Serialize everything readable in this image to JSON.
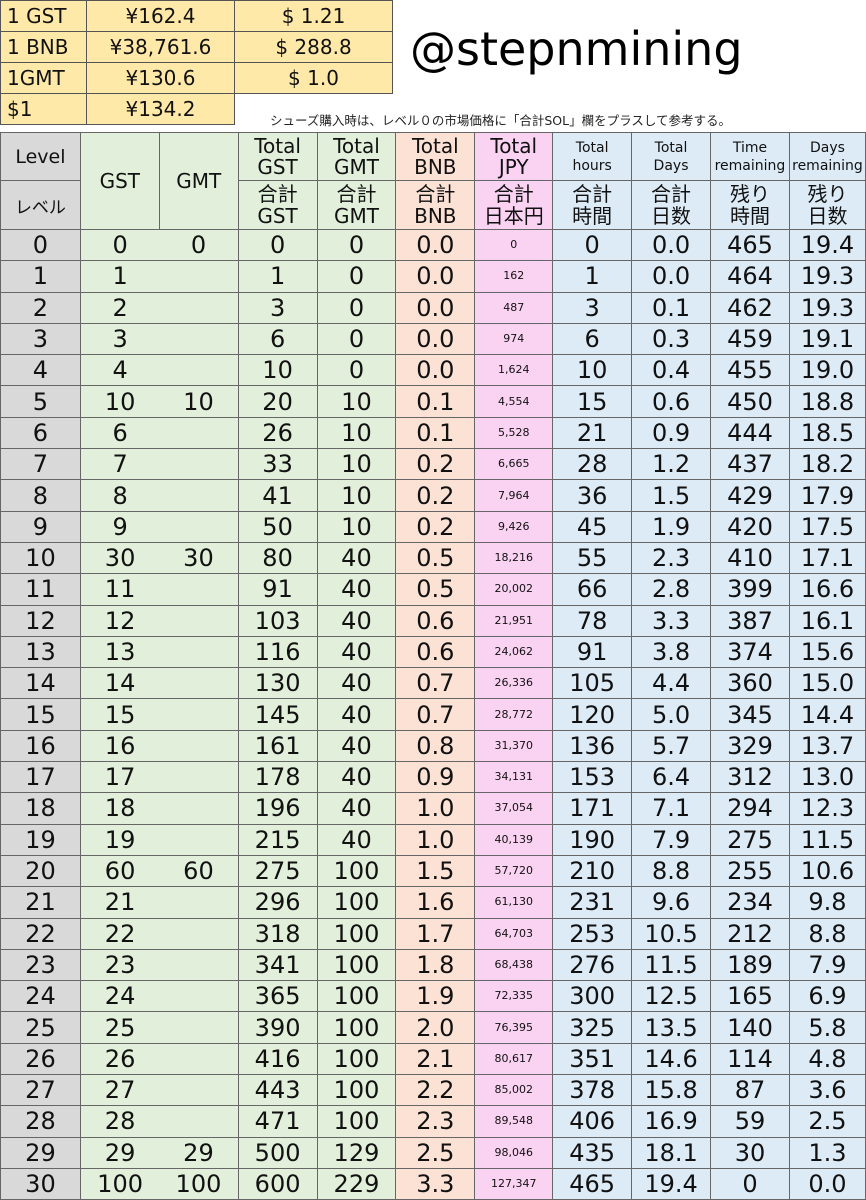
{
  "prices": [
    {
      "unit": "1 GST",
      "jpy": "¥162.4",
      "usd": "$ 1.21"
    },
    {
      "unit": "1 BNB",
      "jpy": "¥38,761.6",
      "usd": "$ 288.8"
    },
    {
      "unit": "1GMT",
      "jpy": "¥130.6",
      "usd": "$ 1.0"
    },
    {
      "unit": "$1",
      "jpy": "¥134.2",
      "usd": ""
    }
  ],
  "handle": "@stepnmining",
  "note": "シューズ購入時は、レベル０の市場価格に「合計SOL」欄をプラスして参考する。",
  "header": {
    "level_en": "Level",
    "level_jp": "レベル",
    "gst": "GST",
    "gmt": "GMT",
    "total_gst": [
      "Total",
      "GST"
    ],
    "total_gmt": [
      "Total",
      "GMT"
    ],
    "total_bnb": [
      "Total",
      "BNB"
    ],
    "total_jpy": [
      "Total",
      "JPY"
    ],
    "total_hours": [
      "Total",
      "hours"
    ],
    "total_days": [
      "Total",
      "Days"
    ],
    "time_remaining": [
      "Time",
      "remaining"
    ],
    "days_remaining": [
      "Days",
      "remaining"
    ],
    "jp_total_gst": [
      "合計",
      "GST"
    ],
    "jp_total_gmt": [
      "合計",
      "GMT"
    ],
    "jp_total_bnb": [
      "合計",
      "BNB"
    ],
    "jp_total_jpy": [
      "合計",
      "日本円"
    ],
    "jp_total_hours": [
      "合計",
      "時間"
    ],
    "jp_total_days": [
      "合計",
      "日数"
    ],
    "jp_time_remaining": [
      "残り",
      "時間"
    ],
    "jp_days_remaining": [
      "残り",
      "日数"
    ]
  },
  "rows": [
    [
      "0",
      "0",
      "0",
      "0",
      "0",
      "0.0",
      "0",
      "0",
      "0.0",
      "465",
      "19.4"
    ],
    [
      "1",
      "1",
      "",
      "1",
      "0",
      "0.0",
      "162",
      "1",
      "0.0",
      "464",
      "19.3"
    ],
    [
      "2",
      "2",
      "",
      "3",
      "0",
      "0.0",
      "487",
      "3",
      "0.1",
      "462",
      "19.3"
    ],
    [
      "3",
      "3",
      "",
      "6",
      "0",
      "0.0",
      "974",
      "6",
      "0.3",
      "459",
      "19.1"
    ],
    [
      "4",
      "4",
      "",
      "10",
      "0",
      "0.0",
      "1,624",
      "10",
      "0.4",
      "455",
      "19.0"
    ],
    [
      "5",
      "10",
      "10",
      "20",
      "10",
      "0.1",
      "4,554",
      "15",
      "0.6",
      "450",
      "18.8"
    ],
    [
      "6",
      "6",
      "",
      "26",
      "10",
      "0.1",
      "5,528",
      "21",
      "0.9",
      "444",
      "18.5"
    ],
    [
      "7",
      "7",
      "",
      "33",
      "10",
      "0.2",
      "6,665",
      "28",
      "1.2",
      "437",
      "18.2"
    ],
    [
      "8",
      "8",
      "",
      "41",
      "10",
      "0.2",
      "7,964",
      "36",
      "1.5",
      "429",
      "17.9"
    ],
    [
      "9",
      "9",
      "",
      "50",
      "10",
      "0.2",
      "9,426",
      "45",
      "1.9",
      "420",
      "17.5"
    ],
    [
      "10",
      "30",
      "30",
      "80",
      "40",
      "0.5",
      "18,216",
      "55",
      "2.3",
      "410",
      "17.1"
    ],
    [
      "11",
      "11",
      "",
      "91",
      "40",
      "0.5",
      "20,002",
      "66",
      "2.8",
      "399",
      "16.6"
    ],
    [
      "12",
      "12",
      "",
      "103",
      "40",
      "0.6",
      "21,951",
      "78",
      "3.3",
      "387",
      "16.1"
    ],
    [
      "13",
      "13",
      "",
      "116",
      "40",
      "0.6",
      "24,062",
      "91",
      "3.8",
      "374",
      "15.6"
    ],
    [
      "14",
      "14",
      "",
      "130",
      "40",
      "0.7",
      "26,336",
      "105",
      "4.4",
      "360",
      "15.0"
    ],
    [
      "15",
      "15",
      "",
      "145",
      "40",
      "0.7",
      "28,772",
      "120",
      "5.0",
      "345",
      "14.4"
    ],
    [
      "16",
      "16",
      "",
      "161",
      "40",
      "0.8",
      "31,370",
      "136",
      "5.7",
      "329",
      "13.7"
    ],
    [
      "17",
      "17",
      "",
      "178",
      "40",
      "0.9",
      "34,131",
      "153",
      "6.4",
      "312",
      "13.0"
    ],
    [
      "18",
      "18",
      "",
      "196",
      "40",
      "1.0",
      "37,054",
      "171",
      "7.1",
      "294",
      "12.3"
    ],
    [
      "19",
      "19",
      "",
      "215",
      "40",
      "1.0",
      "40,139",
      "190",
      "7.9",
      "275",
      "11.5"
    ],
    [
      "20",
      "60",
      "60",
      "275",
      "100",
      "1.5",
      "57,720",
      "210",
      "8.8",
      "255",
      "10.6"
    ],
    [
      "21",
      "21",
      "",
      "296",
      "100",
      "1.6",
      "61,130",
      "231",
      "9.6",
      "234",
      "9.8"
    ],
    [
      "22",
      "22",
      "",
      "318",
      "100",
      "1.7",
      "64,703",
      "253",
      "10.5",
      "212",
      "8.8"
    ],
    [
      "23",
      "23",
      "",
      "341",
      "100",
      "1.8",
      "68,438",
      "276",
      "11.5",
      "189",
      "7.9"
    ],
    [
      "24",
      "24",
      "",
      "365",
      "100",
      "1.9",
      "72,335",
      "300",
      "12.5",
      "165",
      "6.9"
    ],
    [
      "25",
      "25",
      "",
      "390",
      "100",
      "2.0",
      "76,395",
      "325",
      "13.5",
      "140",
      "5.8"
    ],
    [
      "26",
      "26",
      "",
      "416",
      "100",
      "2.1",
      "80,617",
      "351",
      "14.6",
      "114",
      "4.8"
    ],
    [
      "27",
      "27",
      "",
      "443",
      "100",
      "2.2",
      "85,002",
      "378",
      "15.8",
      "87",
      "3.6"
    ],
    [
      "28",
      "28",
      "",
      "471",
      "100",
      "2.3",
      "89,548",
      "406",
      "16.9",
      "59",
      "2.5"
    ],
    [
      "29",
      "29",
      "29",
      "500",
      "129",
      "2.5",
      "98,046",
      "435",
      "18.1",
      "30",
      "1.3"
    ],
    [
      "30",
      "100",
      "100",
      "600",
      "229",
      "3.3",
      "127,347",
      "465",
      "19.4",
      "0",
      "0.0"
    ]
  ]
}
